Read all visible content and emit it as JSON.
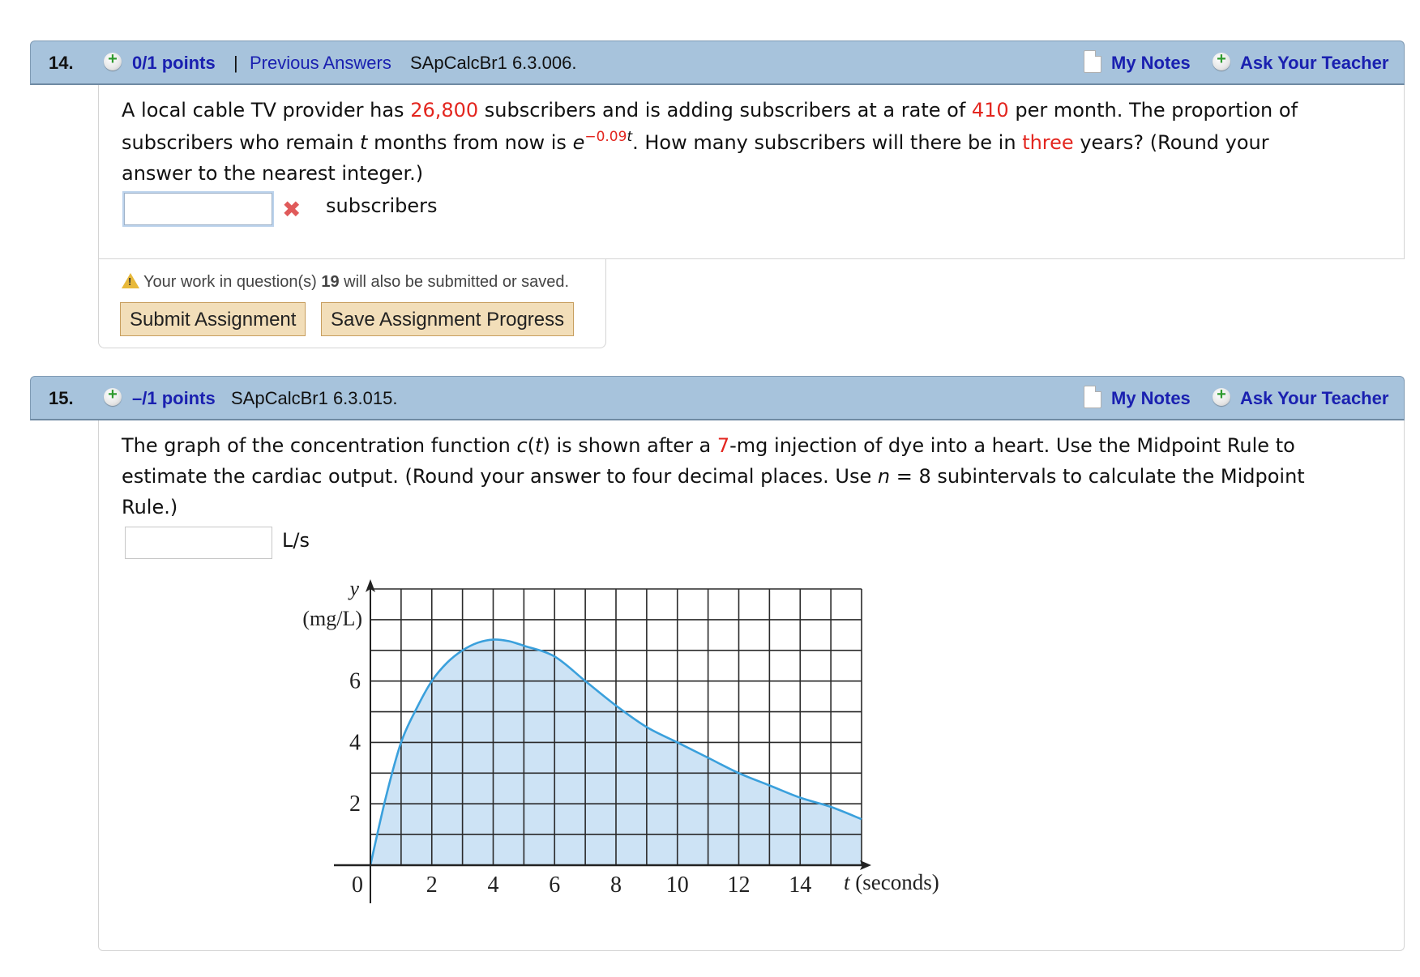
{
  "questions": [
    {
      "number": "14.",
      "points": "0/1 points",
      "separator": "|",
      "previous_answers": "Previous Answers",
      "code": "SApCalcBr1 6.3.006.",
      "my_notes": "My Notes",
      "ask_teacher": "Ask Your Teacher",
      "text": {
        "l1a": "A local cable TV provider has ",
        "l1b": "26,800",
        "l1c": " subscribers and is adding subscribers at a rate of ",
        "l1d": "410",
        "l1e": " per month. The proportion of",
        "l2a": "subscribers who remain ",
        "l2b": "t",
        "l2c": " months from now is  ",
        "l2d": "e",
        "l2e": "−0.09",
        "l2f": "t",
        "l2g": ".  How many subscribers will there be in ",
        "l2h": "three",
        "l2i": " years? (Round your",
        "l3": "answer to the nearest integer.)"
      },
      "answer_value": "",
      "answer_status": "incorrect",
      "unit": "subscribers"
    },
    {
      "number": "15.",
      "points": "–/1 points",
      "code": "SApCalcBr1 6.3.015.",
      "my_notes": "My Notes",
      "ask_teacher": "Ask Your Teacher",
      "text": {
        "l1a": "The graph of the concentration function ",
        "l1b": "c",
        "l1c": "(",
        "l1d": "t",
        "l1e": ") is shown after a ",
        "l1f": "7",
        "l1g": "-mg injection of dye into a heart. Use the Midpoint Rule to",
        "l2a": "estimate the cardiac output. (Round your answer to four decimal places. Use ",
        "l2b": "n",
        "l2c": " = 8 subintervals to calculate the Midpoint",
        "l3": "Rule.)"
      },
      "answer_value": "",
      "unit": "L/s"
    }
  ],
  "submit_area": {
    "warning_pre": "Your work in question(s) ",
    "warning_num": "19",
    "warning_post": " will also be submitted or saved.",
    "submit_label": "Submit Assignment",
    "save_label": "Save Assignment Progress"
  },
  "chart_data": {
    "type": "area",
    "title": "",
    "xlabel": "t (seconds)",
    "ylabel_var": "y",
    "ylabel_unit": "(mg/L)",
    "xlim": [
      0,
      16
    ],
    "ylim": [
      0,
      9
    ],
    "grid": true,
    "grid_step_x": 1,
    "grid_step_y": 1,
    "x_ticks": [
      0,
      2,
      4,
      6,
      8,
      10,
      12,
      14
    ],
    "y_ticks": [
      2,
      4,
      6
    ],
    "x": [
      0,
      0.5,
      1,
      1.5,
      2,
      2.5,
      3,
      3.5,
      4,
      4.5,
      5,
      6,
      7,
      8,
      9,
      10,
      11,
      12,
      13,
      14,
      15,
      16
    ],
    "y": [
      0,
      2.2,
      4.0,
      5.1,
      6.0,
      6.6,
      7.0,
      7.25,
      7.35,
      7.3,
      7.15,
      6.8,
      6.0,
      5.2,
      4.5,
      4.0,
      3.5,
      3.0,
      2.6,
      2.2,
      1.9,
      1.5
    ],
    "line_color": "#3aa0dc",
    "fill_color": "#cde3f5"
  }
}
